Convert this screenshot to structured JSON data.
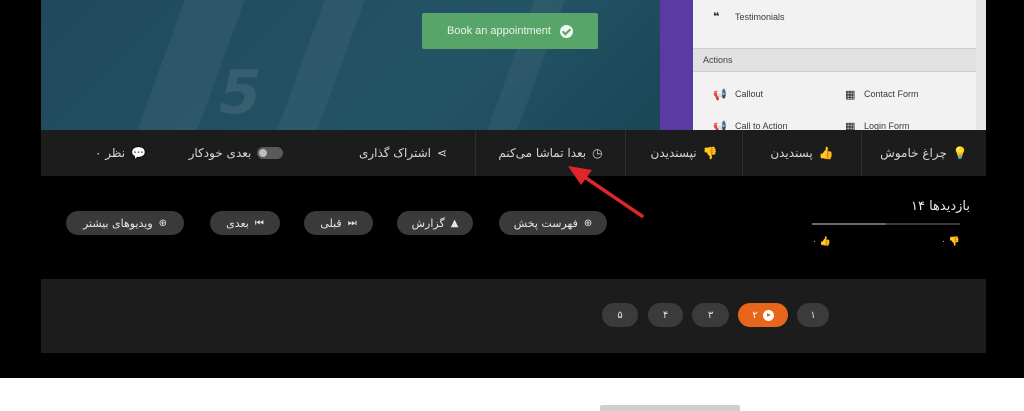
{
  "video": {
    "book_button": "Book an appointment",
    "panel": {
      "testimonials": "Testimonials",
      "section": "Actions",
      "callout": "Callout",
      "contact_form": "Contact Form",
      "call_to_action": "Call to Action",
      "login_form": "Login Form"
    }
  },
  "actions": {
    "light": "چراغ خاموش",
    "like": "پسندیدن",
    "dislike": "نپسندیدن",
    "watch_later": "بعدا تماشا می‌کنم",
    "share": "اشتراک گذاری",
    "autoplay": "بعدی خودکار",
    "comments": "۰ نظر"
  },
  "info": {
    "views": "۱۴ بازدیدها",
    "likes": "۰",
    "dislikes": "۰",
    "buttons": {
      "playlist": "فهرست پخش",
      "report": "گزارش",
      "prev": "قبلی",
      "next": "بعدی",
      "more_videos": "ویدیوهای بیشتر"
    }
  },
  "pagination": [
    "۱",
    "۲",
    "۳",
    "۴",
    "۵"
  ],
  "colors": {
    "accent": "#e8661c",
    "book_button": "#58a56a",
    "annotation": "#e0262b"
  }
}
